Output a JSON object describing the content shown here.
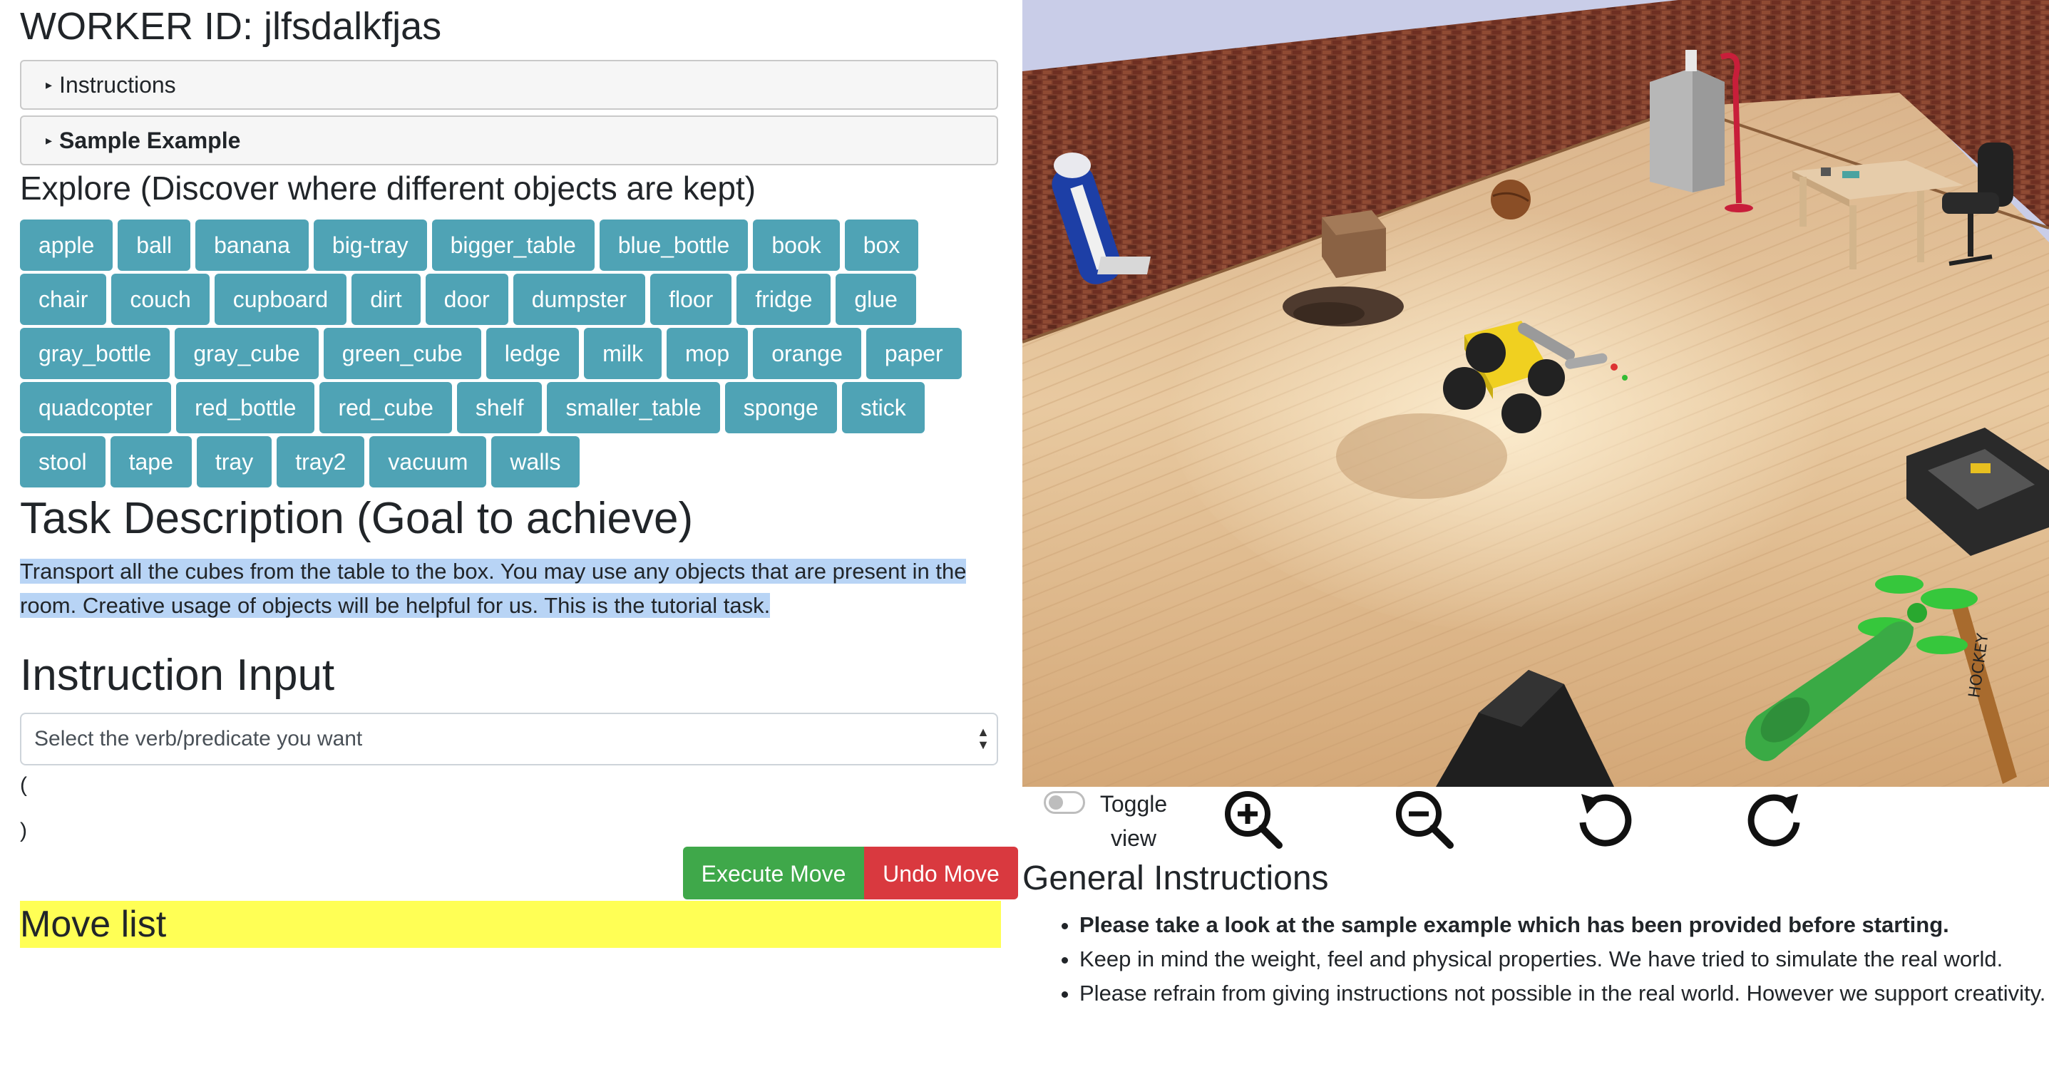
{
  "header": {
    "worker_id": "WORKER ID: jlfsdalkfjas"
  },
  "accordions": {
    "instructions": "Instructions",
    "sample_example": "Sample Example"
  },
  "explore": {
    "heading": "Explore (Discover where different objects are kept)",
    "objects": [
      "apple",
      "ball",
      "banana",
      "big-tray",
      "bigger_table",
      "blue_bottle",
      "book",
      "box",
      "chair",
      "couch",
      "cupboard",
      "dirt",
      "door",
      "dumpster",
      "floor",
      "fridge",
      "glue",
      "gray_bottle",
      "gray_cube",
      "green_cube",
      "ledge",
      "milk",
      "mop",
      "orange",
      "paper",
      "quadcopter",
      "red_bottle",
      "red_cube",
      "shelf",
      "smaller_table",
      "sponge",
      "stick",
      "stool",
      "tape",
      "tray",
      "tray2",
      "vacuum",
      "walls"
    ]
  },
  "task": {
    "heading": "Task Description (Goal to achieve)",
    "text": "Transport all the cubes from the table to the box. You may use any objects that are present in the room. Creative usage of objects will be helpful for us. This is the tutorial task."
  },
  "instruction_input": {
    "heading": "Instruction Input",
    "select_value": "Select the verb/predicate you want",
    "open_paren": "(",
    "close_paren": ")"
  },
  "actions": {
    "execute": "Execute Move",
    "undo": "Undo Move"
  },
  "move_list": {
    "heading": "Move list"
  },
  "view_controls": {
    "toggle_label": "Toggle view",
    "toggle_on": false,
    "icons": [
      "zoom-in-icon",
      "zoom-out-icon",
      "rotate-left-icon",
      "rotate-right-icon"
    ]
  },
  "general": {
    "heading": "General Instructions",
    "items": [
      "Please take a look at the sample example which has been provided before starting.",
      "Keep in mind the weight, feel and physical properties. We have tried to simulate the real world.",
      "Please refrain from giving instructions not possible in the real world. However we support creativity."
    ]
  },
  "colors": {
    "object_button": "#4fa3b5",
    "execute_button": "#3fa84a",
    "undo_button": "#d9393f",
    "move_list_bg": "#ffff55",
    "task_highlight": "#b8d4f5"
  }
}
